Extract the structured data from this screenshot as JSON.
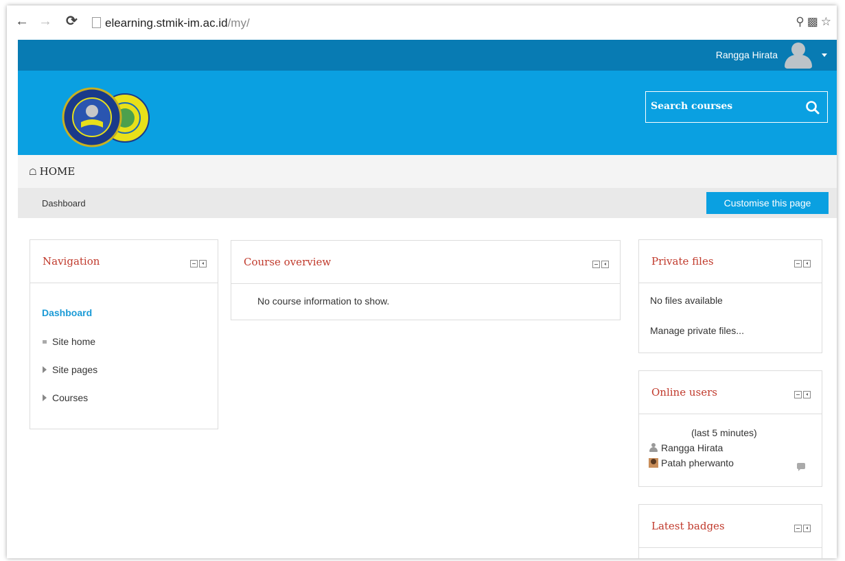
{
  "browser": {
    "url_host": "elearning.stmik-im.ac.id",
    "url_path": "/my/",
    "back_icon": "arrow-left-icon",
    "forward_icon": "arrow-right-icon",
    "reload_icon": "reload-icon"
  },
  "topbar": {
    "user_name": "Rangga Hirata"
  },
  "header": {
    "search_placeholder": "Search courses"
  },
  "homebar": {
    "home_label": "HOME"
  },
  "breadcrumb": {
    "dashboard": "Dashboard",
    "customise_label": "Customise this page"
  },
  "navigation": {
    "title": "Navigation",
    "dashboard": "Dashboard",
    "items": [
      "Site home",
      "Site pages",
      "Courses"
    ]
  },
  "course_overview": {
    "title": "Course overview",
    "empty_text": "No course information to show."
  },
  "private_files": {
    "title": "Private files",
    "empty_text": "No files available",
    "manage_link": "Manage private files..."
  },
  "online_users": {
    "title": "Online users",
    "period": "(last 5 minutes)",
    "users": [
      "Rangga Hirata",
      "Patah pherwanto"
    ]
  },
  "latest_badges": {
    "title": "Latest badges"
  },
  "colors": {
    "topbar": "#087bb3",
    "header": "#0aa0e1",
    "block_title": "#c0392b",
    "link": "#1a9ad6"
  }
}
